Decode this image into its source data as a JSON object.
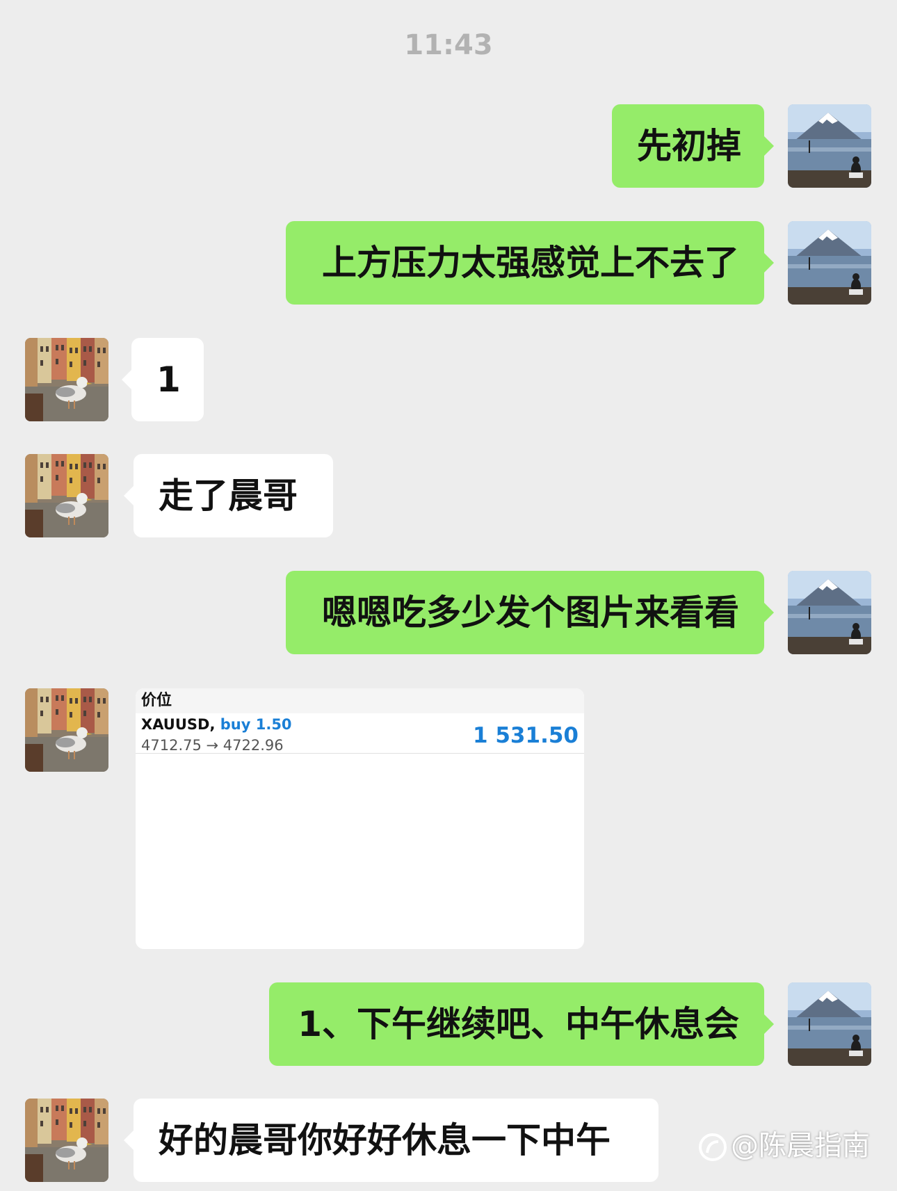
{
  "chat": {
    "timestamp": "11:43",
    "messages": [
      {
        "direction": "out",
        "text": "先初掉"
      },
      {
        "direction": "out",
        "text": "上方压力太强感觉上不去了"
      },
      {
        "direction": "in",
        "text": "1"
      },
      {
        "direction": "in",
        "text": "走了晨哥"
      },
      {
        "direction": "out",
        "text": "嗯嗯吃多少发个图片来看看"
      },
      {
        "direction": "in",
        "type": "image"
      },
      {
        "direction": "out",
        "text": "1、下午继续吧、中午休息会"
      },
      {
        "direction": "in",
        "text": "好的晨哥你好好休息一下中午"
      }
    ],
    "trade_card": {
      "header": "价位",
      "symbol": "XAUUSD,",
      "side": "buy 1.50",
      "prices": "4712.75 → 4722.96",
      "profit": "1 531.50"
    },
    "watermark": "@陈晨指南"
  },
  "colors": {
    "background": "#ededed",
    "outgoing_bubble": "#95ec69",
    "incoming_bubble": "#ffffff",
    "timestamp": "#b2b2b2",
    "profit_blue": "#1a7fd6"
  },
  "icons": {
    "self_avatar": "mountain-lake-avatar-icon",
    "contact_avatar": "seagull-town-avatar-icon"
  }
}
